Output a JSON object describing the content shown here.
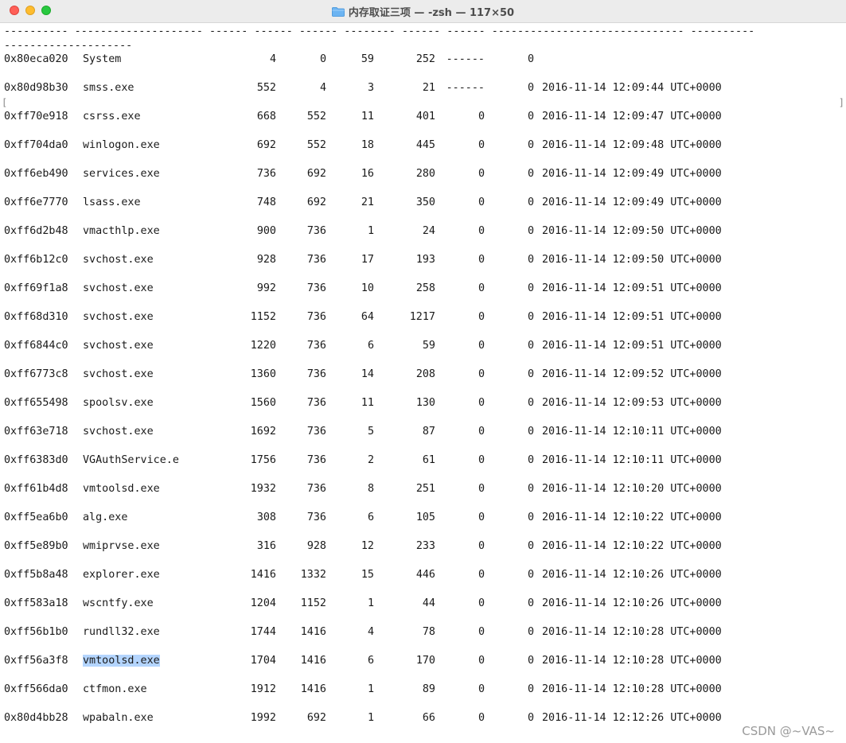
{
  "window": {
    "title": "内存取证三项 — -zsh — 117×50"
  },
  "terminal": {
    "header_line1": "---------- -------------------- ------ ------ ------ -------- ------ ------ ------------------------------ ----------",
    "header_line2": "--------------------",
    "left_bracket": "[",
    "right_bracket": "]",
    "rows": [
      {
        "offset": "0x80eca020",
        "name": "System",
        "pid": "4",
        "ppid": "0",
        "thds": "59",
        "hnds": "252",
        "sess": "------",
        "wow64": "0",
        "start": ""
      },
      {
        "offset": "0x80d98b30",
        "name": "smss.exe",
        "pid": "552",
        "ppid": "4",
        "thds": "3",
        "hnds": "21",
        "sess": "------",
        "wow64": "0",
        "start": "2016-11-14 12:09:44 UTC+0000"
      },
      {
        "offset": "0xff70e918",
        "name": "csrss.exe",
        "pid": "668",
        "ppid": "552",
        "thds": "11",
        "hnds": "401",
        "sess": "0",
        "wow64": "0",
        "start": "2016-11-14 12:09:47 UTC+0000"
      },
      {
        "offset": "0xff704da0",
        "name": "winlogon.exe",
        "pid": "692",
        "ppid": "552",
        "thds": "18",
        "hnds": "445",
        "sess": "0",
        "wow64": "0",
        "start": "2016-11-14 12:09:48 UTC+0000"
      },
      {
        "offset": "0xff6eb490",
        "name": "services.exe",
        "pid": "736",
        "ppid": "692",
        "thds": "16",
        "hnds": "280",
        "sess": "0",
        "wow64": "0",
        "start": "2016-11-14 12:09:49 UTC+0000"
      },
      {
        "offset": "0xff6e7770",
        "name": "lsass.exe",
        "pid": "748",
        "ppid": "692",
        "thds": "21",
        "hnds": "350",
        "sess": "0",
        "wow64": "0",
        "start": "2016-11-14 12:09:49 UTC+0000"
      },
      {
        "offset": "0xff6d2b48",
        "name": "vmacthlp.exe",
        "pid": "900",
        "ppid": "736",
        "thds": "1",
        "hnds": "24",
        "sess": "0",
        "wow64": "0",
        "start": "2016-11-14 12:09:50 UTC+0000"
      },
      {
        "offset": "0xff6b12c0",
        "name": "svchost.exe",
        "pid": "928",
        "ppid": "736",
        "thds": "17",
        "hnds": "193",
        "sess": "0",
        "wow64": "0",
        "start": "2016-11-14 12:09:50 UTC+0000"
      },
      {
        "offset": "0xff69f1a8",
        "name": "svchost.exe",
        "pid": "992",
        "ppid": "736",
        "thds": "10",
        "hnds": "258",
        "sess": "0",
        "wow64": "0",
        "start": "2016-11-14 12:09:51 UTC+0000"
      },
      {
        "offset": "0xff68d310",
        "name": "svchost.exe",
        "pid": "1152",
        "ppid": "736",
        "thds": "64",
        "hnds": "1217",
        "sess": "0",
        "wow64": "0",
        "start": "2016-11-14 12:09:51 UTC+0000"
      },
      {
        "offset": "0xff6844c0",
        "name": "svchost.exe",
        "pid": "1220",
        "ppid": "736",
        "thds": "6",
        "hnds": "59",
        "sess": "0",
        "wow64": "0",
        "start": "2016-11-14 12:09:51 UTC+0000"
      },
      {
        "offset": "0xff6773c8",
        "name": "svchost.exe",
        "pid": "1360",
        "ppid": "736",
        "thds": "14",
        "hnds": "208",
        "sess": "0",
        "wow64": "0",
        "start": "2016-11-14 12:09:52 UTC+0000"
      },
      {
        "offset": "0xff655498",
        "name": "spoolsv.exe",
        "pid": "1560",
        "ppid": "736",
        "thds": "11",
        "hnds": "130",
        "sess": "0",
        "wow64": "0",
        "start": "2016-11-14 12:09:53 UTC+0000"
      },
      {
        "offset": "0xff63e718",
        "name": "svchost.exe",
        "pid": "1692",
        "ppid": "736",
        "thds": "5",
        "hnds": "87",
        "sess": "0",
        "wow64": "0",
        "start": "2016-11-14 12:10:11 UTC+0000"
      },
      {
        "offset": "0xff6383d0",
        "name": "VGAuthService.e",
        "pid": "1756",
        "ppid": "736",
        "thds": "2",
        "hnds": "61",
        "sess": "0",
        "wow64": "0",
        "start": "2016-11-14 12:10:11 UTC+0000"
      },
      {
        "offset": "0xff61b4d8",
        "name": "vmtoolsd.exe",
        "pid": "1932",
        "ppid": "736",
        "thds": "8",
        "hnds": "251",
        "sess": "0",
        "wow64": "0",
        "start": "2016-11-14 12:10:20 UTC+0000"
      },
      {
        "offset": "0xff5ea6b0",
        "name": "alg.exe",
        "pid": "308",
        "ppid": "736",
        "thds": "6",
        "hnds": "105",
        "sess": "0",
        "wow64": "0",
        "start": "2016-11-14 12:10:22 UTC+0000"
      },
      {
        "offset": "0xff5e89b0",
        "name": "wmiprvse.exe",
        "pid": "316",
        "ppid": "928",
        "thds": "12",
        "hnds": "233",
        "sess": "0",
        "wow64": "0",
        "start": "2016-11-14 12:10:22 UTC+0000"
      },
      {
        "offset": "0xff5b8a48",
        "name": "explorer.exe",
        "pid": "1416",
        "ppid": "1332",
        "thds": "15",
        "hnds": "446",
        "sess": "0",
        "wow64": "0",
        "start": "2016-11-14 12:10:26 UTC+0000"
      },
      {
        "offset": "0xff583a18",
        "name": "wscntfy.exe",
        "pid": "1204",
        "ppid": "1152",
        "thds": "1",
        "hnds": "44",
        "sess": "0",
        "wow64": "0",
        "start": "2016-11-14 12:10:26 UTC+0000"
      },
      {
        "offset": "0xff56b1b0",
        "name": "rundll32.exe",
        "pid": "1744",
        "ppid": "1416",
        "thds": "4",
        "hnds": "78",
        "sess": "0",
        "wow64": "0",
        "start": "2016-11-14 12:10:28 UTC+0000"
      },
      {
        "offset": "0xff56a3f8",
        "name": "vmtoolsd.exe",
        "pid": "1704",
        "ppid": "1416",
        "thds": "6",
        "hnds": "170",
        "sess": "0",
        "wow64": "0",
        "start": "2016-11-14 12:10:28 UTC+0000",
        "selected": true
      },
      {
        "offset": "0xff566da0",
        "name": "ctfmon.exe",
        "pid": "1912",
        "ppid": "1416",
        "thds": "1",
        "hnds": "89",
        "sess": "0",
        "wow64": "0",
        "start": "2016-11-14 12:10:28 UTC+0000"
      },
      {
        "offset": "0x80d4bb28",
        "name": "wpabaln.exe",
        "pid": "1992",
        "ppid": "692",
        "thds": "1",
        "hnds": "66",
        "sess": "0",
        "wow64": "0",
        "start": "2016-11-14 12:12:26 UTC+0000"
      }
    ]
  },
  "watermark": "CSDN @~VAS~",
  "colors": {
    "selection": "#b4d5fe",
    "close": "#ff5f57",
    "minimize": "#febc2e",
    "maximize": "#28c840"
  },
  "icons": {
    "title_icon": "folder-icon"
  }
}
